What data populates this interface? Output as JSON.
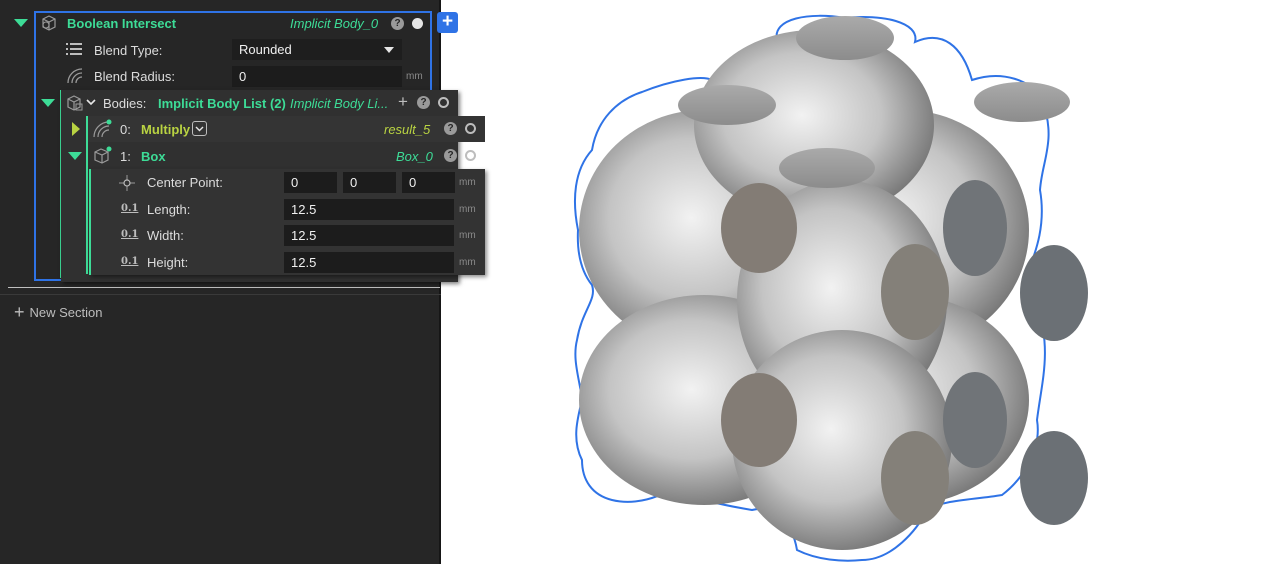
{
  "node": {
    "title": "Boolean Intersect",
    "output": "Implicit Body_0",
    "blend_type_label": "Blend Type:",
    "blend_type_value": "Rounded",
    "blend_radius_label": "Blend Radius:",
    "blend_radius_value": "0",
    "unit": "mm",
    "add_label": "+"
  },
  "bodies": {
    "label": "Bodies:",
    "list_name": "Implicit Body List (2)",
    "output": "Implicit Body Li...",
    "items": [
      {
        "index": "0:",
        "name": "Multiply",
        "output": "result_5"
      },
      {
        "index": "1:",
        "name": "Box",
        "output": "Box_0"
      }
    ]
  },
  "box": {
    "center_label": "Center Point:",
    "center_x": "0",
    "center_y": "0",
    "center_z": "0",
    "length_label": "Length:",
    "length_value": "12.5",
    "width_label": "Width:",
    "width_value": "12.5",
    "height_label": "Height:",
    "height_value": "12.5",
    "unit": "mm",
    "value_icon": "0.1"
  },
  "new_section": "New Section",
  "help_glyph": "?",
  "colors": {
    "accent_green": "#3ddc97",
    "accent_yellow": "#b9d342",
    "selection_blue": "#2f73e6",
    "panel_bg": "#262626"
  }
}
